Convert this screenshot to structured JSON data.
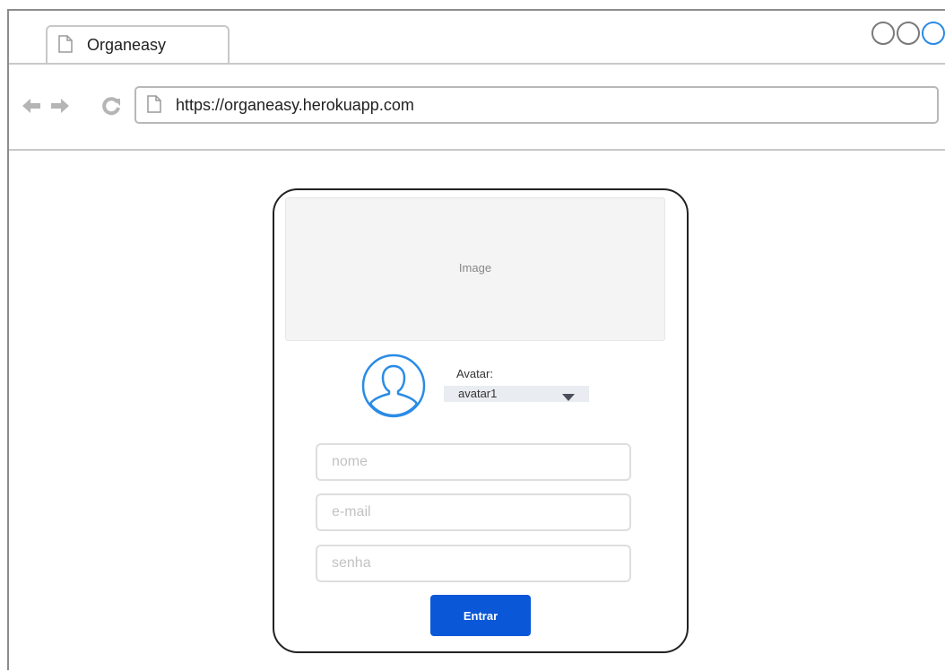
{
  "browser": {
    "tab_title": "Organeasy",
    "url": "https://organeasy.herokuapp.com",
    "icons": {
      "tab": "page-icon",
      "back": "back-arrow-icon",
      "forward": "forward-arrow-icon",
      "reload": "reload-icon",
      "address": "page-icon"
    }
  },
  "login_card": {
    "image_placeholder": "Image",
    "avatar": {
      "label": "Avatar:",
      "selected": "avatar1",
      "icon": "user-avatar-icon"
    },
    "fields": {
      "name_placeholder": "nome",
      "email_placeholder": "e-mail",
      "password_placeholder": "senha"
    },
    "submit_label": "Entrar"
  },
  "colors": {
    "accent": "#0a57d8",
    "avatar_stroke": "#2a8be6",
    "card_border": "#222222"
  }
}
